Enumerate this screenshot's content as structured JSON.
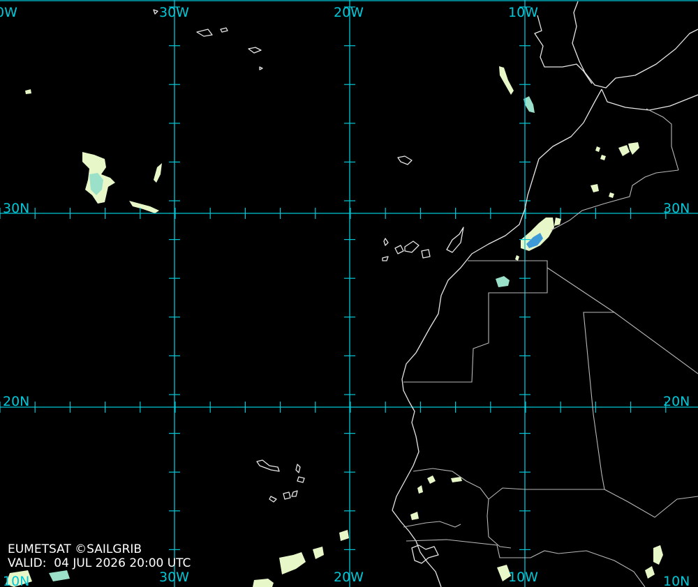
{
  "map": {
    "colors": {
      "background": "#000000",
      "grid": "#00c8d8",
      "coast": "#e6e6e6",
      "border": "#b8b8b8",
      "cloud_light": "#e8f7c8",
      "cloud_mid": "#9be0c8",
      "cloud_deep": "#3f9ad8"
    },
    "labels": {
      "top_lon": [
        "0W",
        "30W",
        "20W",
        "10W"
      ],
      "bottom_lon": [
        "30W",
        "20W",
        "10W",
        "10N"
      ],
      "left_lat": [
        "30N",
        "20N"
      ],
      "right_lat": [
        "30N",
        "20N"
      ],
      "corner_left": "10N"
    }
  },
  "credit": {
    "text": "EUMETSAT ©SAILGRIB"
  },
  "valid": {
    "label": "VALID:",
    "time": "04 JUL 2026 20:00 UTC"
  }
}
